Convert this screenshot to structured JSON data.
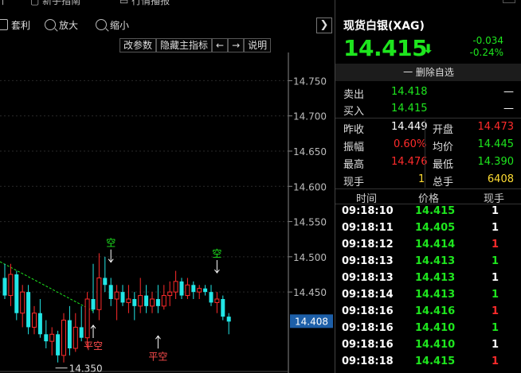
{
  "top_menu": [
    {
      "label": "新手指南",
      "icon": "guide-icon"
    },
    {
      "label": "行情播报",
      "icon": "broadcast-icon"
    }
  ],
  "toolbar": {
    "taoli": "套利",
    "zoom_in": "放大",
    "zoom_out": "缩小",
    "nav_next": "❯"
  },
  "subbar": [
    "改参数",
    "隐藏主指标",
    "←",
    "→",
    "说明"
  ],
  "panel": {
    "title": "现货白银(XAG)",
    "price": "14.415",
    "arrow": "⬇",
    "change": "-0.034",
    "change_pct": "-0.24%",
    "remove_label": "一 删除自选",
    "sell_label": "卖出",
    "sell_price": "14.418",
    "sell_vol": "—",
    "buy_label": "买入",
    "buy_price": "14.415",
    "buy_vol": "—",
    "stats": {
      "prev_close_label": "昨收",
      "prev_close": "14.449",
      "open_label": "开盘",
      "open": "14.473",
      "amplitude_label": "振幅",
      "amplitude": "0.60%",
      "avg_label": "均价",
      "avg": "14.445",
      "high_label": "最高",
      "high": "14.476",
      "low_label": "最低",
      "low": "14.390",
      "cur_vol_label": "现手",
      "cur_vol": "1",
      "total_vol_label": "总手",
      "total_vol": "6408"
    },
    "ticks_header": {
      "time": "时间",
      "price": "价格",
      "vol": "现手"
    },
    "ticks": [
      {
        "time": "09:18:10",
        "price": "14.415",
        "vol": "1",
        "vol_color": "w"
      },
      {
        "time": "09:18:11",
        "price": "14.405",
        "vol": "1",
        "vol_color": "w"
      },
      {
        "time": "09:18:12",
        "price": "14.414",
        "vol": "1",
        "vol_color": "r"
      },
      {
        "time": "09:18:13",
        "price": "14.413",
        "vol": "1",
        "vol_color": "g"
      },
      {
        "time": "09:18:13",
        "price": "14.413",
        "vol": "1",
        "vol_color": "w"
      },
      {
        "time": "09:18:14",
        "price": "14.413",
        "vol": "1",
        "vol_color": "g"
      },
      {
        "time": "09:18:16",
        "price": "14.416",
        "vol": "1",
        "vol_color": "r"
      },
      {
        "time": "09:18:16",
        "price": "14.410",
        "vol": "1",
        "vol_color": "g"
      },
      {
        "time": "09:18:16",
        "price": "14.410",
        "vol": "1",
        "vol_color": "w"
      },
      {
        "time": "09:18:18",
        "price": "14.415",
        "vol": "1",
        "vol_color": "r"
      }
    ]
  },
  "chart_data": {
    "type": "candlestick",
    "y_ticks": [
      "14.750",
      "14.700",
      "14.650",
      "14.600",
      "14.550",
      "14.500",
      "14.450"
    ],
    "y_tick_values": [
      14.75,
      14.7,
      14.65,
      14.6,
      14.55,
      14.5,
      14.45
    ],
    "ylim": [
      14.335,
      14.79
    ],
    "current_price_label": "14.408",
    "current_price": 14.408,
    "low_label": "14.350",
    "low_value": 14.35,
    "signals": [
      {
        "text": "空",
        "index": 18,
        "price": 14.49,
        "color": "#1ee61e",
        "dir": "down"
      },
      {
        "text": "平空",
        "index": 15,
        "price": 14.405,
        "color": "#ff4d4d",
        "dir": "up"
      },
      {
        "text": "平空",
        "index": 26,
        "price": 14.39,
        "color": "#ff4d4d",
        "dir": "up"
      },
      {
        "text": "空",
        "index": 36,
        "price": 14.475,
        "color": "#1ee61e",
        "dir": "down"
      }
    ],
    "trend_line": {
      "from_index": 0,
      "from_price": 14.493,
      "to_index": 15,
      "to_price": 14.423
    },
    "candles": [
      {
        "o": 14.47,
        "h": 14.49,
        "l": 14.44,
        "c": 14.445
      },
      {
        "o": 14.445,
        "h": 14.49,
        "l": 14.43,
        "c": 14.475
      },
      {
        "o": 14.475,
        "h": 14.48,
        "l": 14.41,
        "c": 14.42
      },
      {
        "o": 14.42,
        "h": 14.46,
        "l": 14.4,
        "c": 14.45
      },
      {
        "o": 14.45,
        "h": 14.46,
        "l": 14.39,
        "c": 14.4
      },
      {
        "o": 14.4,
        "h": 14.43,
        "l": 14.39,
        "c": 14.42
      },
      {
        "o": 14.42,
        "h": 14.44,
        "l": 14.385,
        "c": 14.39
      },
      {
        "o": 14.39,
        "h": 14.41,
        "l": 14.37,
        "c": 14.38
      },
      {
        "o": 14.38,
        "h": 14.4,
        "l": 14.36,
        "c": 14.39
      },
      {
        "o": 14.39,
        "h": 14.395,
        "l": 14.35,
        "c": 14.36
      },
      {
        "o": 14.36,
        "h": 14.42,
        "l": 14.35,
        "c": 14.41
      },
      {
        "o": 14.41,
        "h": 14.43,
        "l": 14.36,
        "c": 14.37
      },
      {
        "o": 14.37,
        "h": 14.42,
        "l": 14.365,
        "c": 14.4
      },
      {
        "o": 14.4,
        "h": 14.43,
        "l": 14.38,
        "c": 14.385
      },
      {
        "o": 14.385,
        "h": 14.45,
        "l": 14.37,
        "c": 14.44
      },
      {
        "o": 14.44,
        "h": 14.49,
        "l": 14.42,
        "c": 14.425
      },
      {
        "o": 14.425,
        "h": 14.505,
        "l": 14.41,
        "c": 14.47
      },
      {
        "o": 14.47,
        "h": 14.5,
        "l": 14.45,
        "c": 14.46
      },
      {
        "o": 14.46,
        "h": 14.47,
        "l": 14.43,
        "c": 14.44
      },
      {
        "o": 14.44,
        "h": 14.46,
        "l": 14.41,
        "c": 14.45
      },
      {
        "o": 14.45,
        "h": 14.46,
        "l": 14.43,
        "c": 14.435
      },
      {
        "o": 14.435,
        "h": 14.46,
        "l": 14.42,
        "c": 14.44
      },
      {
        "o": 14.44,
        "h": 14.45,
        "l": 14.41,
        "c": 14.43
      },
      {
        "o": 14.43,
        "h": 14.47,
        "l": 14.42,
        "c": 14.445
      },
      {
        "o": 14.445,
        "h": 14.46,
        "l": 14.42,
        "c": 14.43
      },
      {
        "o": 14.43,
        "h": 14.45,
        "l": 14.42,
        "c": 14.44
      },
      {
        "o": 14.44,
        "h": 14.46,
        "l": 14.42,
        "c": 14.43
      },
      {
        "o": 14.43,
        "h": 14.46,
        "l": 14.425,
        "c": 14.445
      },
      {
        "o": 14.445,
        "h": 14.465,
        "l": 14.43,
        "c": 14.45
      },
      {
        "o": 14.45,
        "h": 14.48,
        "l": 14.44,
        "c": 14.465
      },
      {
        "o": 14.465,
        "h": 14.47,
        "l": 14.44,
        "c": 14.445
      },
      {
        "o": 14.445,
        "h": 14.47,
        "l": 14.44,
        "c": 14.46
      },
      {
        "o": 14.46,
        "h": 14.465,
        "l": 14.44,
        "c": 14.45
      },
      {
        "o": 14.45,
        "h": 14.46,
        "l": 14.44,
        "c": 14.455
      },
      {
        "o": 14.455,
        "h": 14.46,
        "l": 14.445,
        "c": 14.45
      },
      {
        "o": 14.45,
        "h": 14.46,
        "l": 14.43,
        "c": 14.435
      },
      {
        "o": 14.435,
        "h": 14.45,
        "l": 14.42,
        "c": 14.44
      },
      {
        "o": 14.44,
        "h": 14.445,
        "l": 14.41,
        "c": 14.415
      },
      {
        "o": 14.415,
        "h": 14.42,
        "l": 14.39,
        "c": 14.408
      }
    ],
    "colors": {
      "up": "#ff2b2b",
      "down": "#22e6e6",
      "trend": "#1ee61e",
      "axis": "#888888"
    }
  }
}
